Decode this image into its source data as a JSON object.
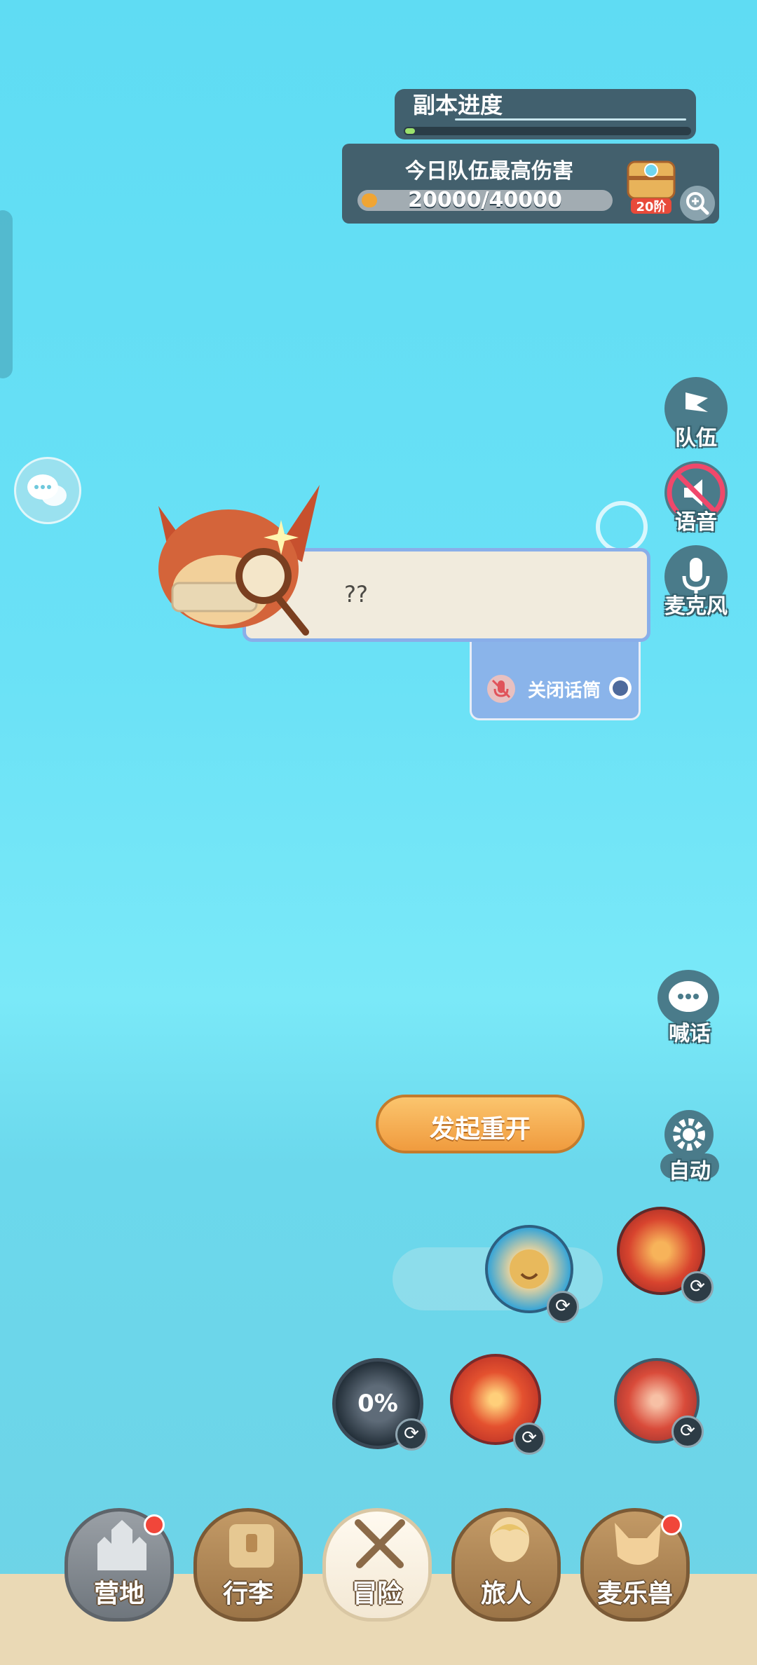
{
  "hud": {
    "dungeon_progress": {
      "label": "副本进度",
      "progress": 0.03
    },
    "daily_damage": {
      "label": "今日队伍最高伤害",
      "value_text": "20000/40000",
      "current": 20000,
      "max": 40000,
      "tier_badge": "20阶"
    }
  },
  "right_controls": {
    "team": "队伍",
    "voice": "语音",
    "mic": "麦克风",
    "shout": "喊话",
    "auto": "自动"
  },
  "dialog": {
    "speech_text": "??",
    "mic_option": "关闭话筒"
  },
  "restart": {
    "label": "发起重开"
  },
  "skills": {
    "dark_skill_percent": "0%"
  },
  "nav": {
    "items": [
      {
        "label": "营地",
        "badge": true
      },
      {
        "label": "行李",
        "badge": false
      },
      {
        "label": "冒险",
        "badge": false,
        "active": true
      },
      {
        "label": "旅人",
        "badge": false
      },
      {
        "label": "麦乐兽",
        "badge": true
      }
    ]
  },
  "colors": {
    "sky": "#6ae1f6",
    "panel": "#43606d",
    "accent_orange": "#f09b3e",
    "badge_red": "#f1463a"
  }
}
